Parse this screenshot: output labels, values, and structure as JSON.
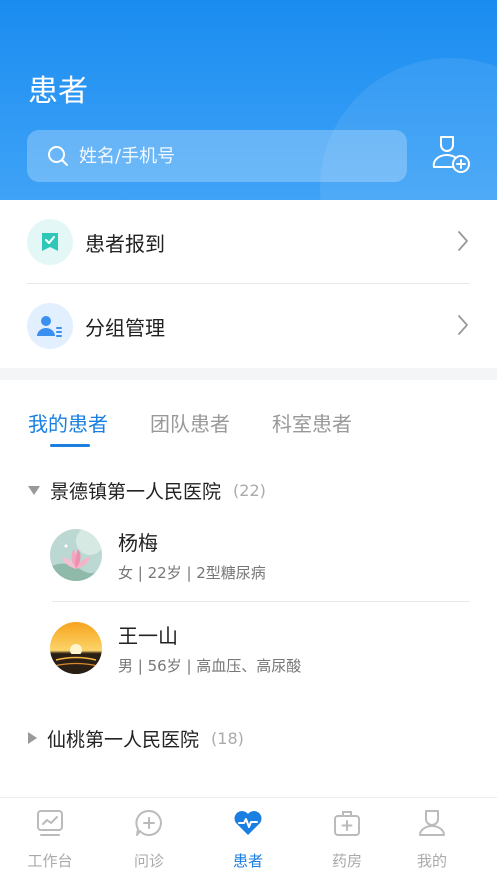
{
  "header": {
    "title": "患者",
    "search_placeholder": "姓名/手机号"
  },
  "menu": [
    {
      "label": "患者报到",
      "icon": "check-bookmark-icon",
      "icon_bg": "#e3f8f6",
      "icon_color": "#2fc8b8"
    },
    {
      "label": "分组管理",
      "icon": "group-manage-icon",
      "icon_bg": "#e1efff",
      "icon_color": "#3b8ff0"
    }
  ],
  "tabs": [
    "我的患者",
    "团队患者",
    "科室患者"
  ],
  "active_tab": 0,
  "groups": [
    {
      "name": "景德镇第一人民医院",
      "count": "(22)",
      "expanded": true,
      "patients": [
        {
          "name": "杨梅",
          "meta": "女 | 22岁 | 2型糖尿病",
          "avatar": "lotus-avatar"
        },
        {
          "name": "王一山",
          "meta": "男 | 56岁 | 高血压、高尿酸",
          "avatar": "sunset-avatar"
        }
      ]
    },
    {
      "name": "仙桃第一人民医院",
      "count": "(18)",
      "expanded": false,
      "patients": []
    }
  ],
  "tabbar": [
    {
      "label": "工作台",
      "icon": "chart-icon"
    },
    {
      "label": "问诊",
      "icon": "chat-plus-icon"
    },
    {
      "label": "患者",
      "icon": "heart-pulse-icon"
    },
    {
      "label": "药房",
      "icon": "medkit-icon"
    },
    {
      "label": "我的",
      "icon": "user-icon"
    }
  ],
  "active_tabbar": 2,
  "colors": {
    "accent": "#1a7fe0",
    "header_top": "#1a8cf0",
    "header_bottom": "#3fa3f7"
  }
}
